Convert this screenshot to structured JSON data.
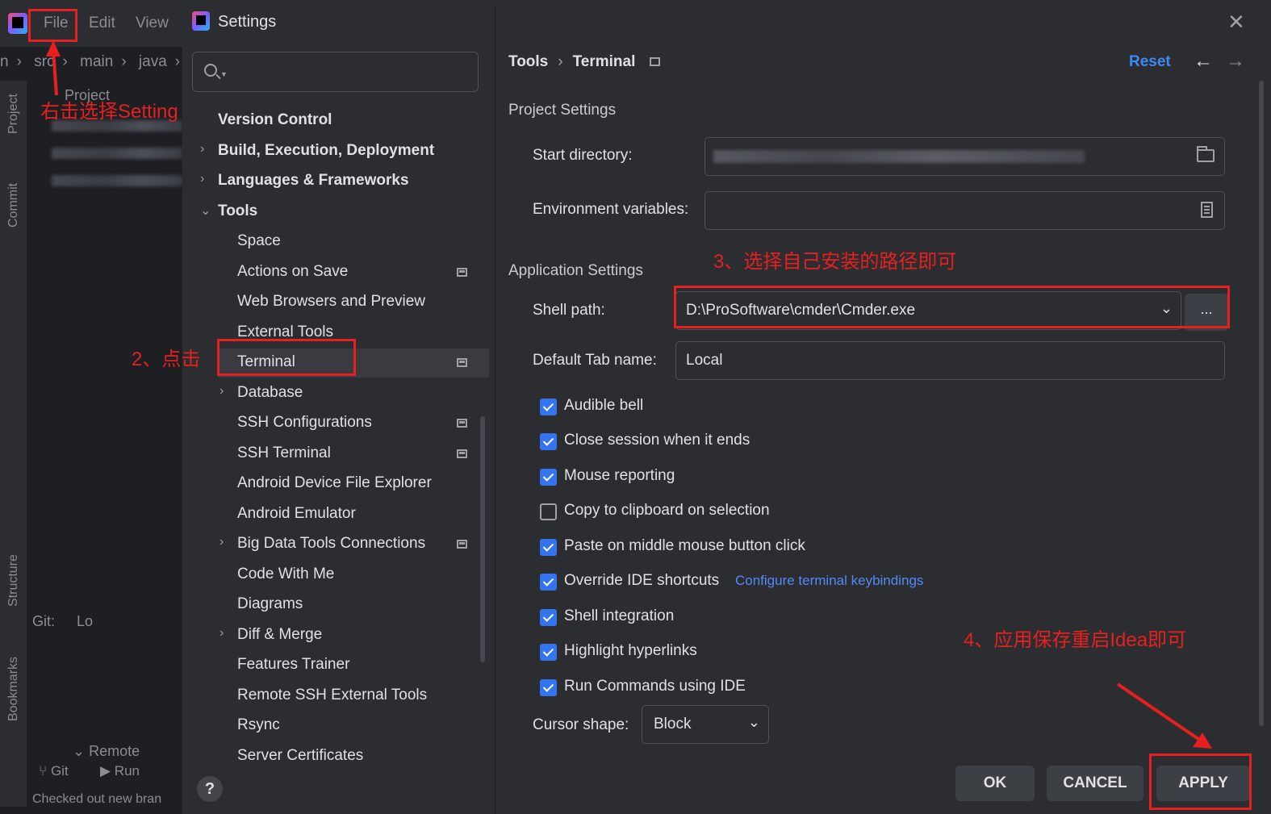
{
  "ide": {
    "menu": [
      "File",
      "Edit",
      "View"
    ],
    "breadcrumb": [
      "n",
      "src",
      "main",
      "java"
    ],
    "left_stripe": [
      "Project",
      "Commit",
      "Structure",
      "Bookmarks"
    ],
    "project_label": "Project",
    "git_tab": "Git:",
    "git_local": "Lo",
    "remote": "Remote",
    "bottom_tools": [
      "Git",
      "Run"
    ],
    "status": "Checked out new bran"
  },
  "dialog": {
    "title": "Settings",
    "search_placeholder": "",
    "tree": [
      {
        "label": "Version Control",
        "level": 0,
        "bold": true,
        "chevron": "",
        "project": false
      },
      {
        "label": "Build, Execution, Deployment",
        "level": 0,
        "bold": true,
        "chevron": "right",
        "project": false
      },
      {
        "label": "Languages & Frameworks",
        "level": 0,
        "bold": true,
        "chevron": "right",
        "project": false
      },
      {
        "label": "Tools",
        "level": 0,
        "bold": true,
        "chevron": "down",
        "project": false
      },
      {
        "label": "Space",
        "level": 1,
        "bold": false,
        "chevron": "",
        "project": false
      },
      {
        "label": "Actions on Save",
        "level": 1,
        "bold": false,
        "chevron": "",
        "project": true
      },
      {
        "label": "Web Browsers and Preview",
        "level": 1,
        "bold": false,
        "chevron": "",
        "project": false
      },
      {
        "label": "External Tools",
        "level": 1,
        "bold": false,
        "chevron": "",
        "project": false
      },
      {
        "label": "Terminal",
        "level": 1,
        "bold": false,
        "chevron": "",
        "project": true,
        "selected": true
      },
      {
        "label": "Database",
        "level": 1,
        "bold": false,
        "chevron": "right",
        "project": false
      },
      {
        "label": "SSH Configurations",
        "level": 1,
        "bold": false,
        "chevron": "",
        "project": true
      },
      {
        "label": "SSH Terminal",
        "level": 1,
        "bold": false,
        "chevron": "",
        "project": true
      },
      {
        "label": "Android Device File Explorer",
        "level": 1,
        "bold": false,
        "chevron": "",
        "project": false
      },
      {
        "label": "Android Emulator",
        "level": 1,
        "bold": false,
        "chevron": "",
        "project": false
      },
      {
        "label": "Big Data Tools Connections",
        "level": 1,
        "bold": false,
        "chevron": "right",
        "project": true
      },
      {
        "label": "Code With Me",
        "level": 1,
        "bold": false,
        "chevron": "",
        "project": false
      },
      {
        "label": "Diagrams",
        "level": 1,
        "bold": false,
        "chevron": "",
        "project": false
      },
      {
        "label": "Diff & Merge",
        "level": 1,
        "bold": false,
        "chevron": "right",
        "project": false
      },
      {
        "label": "Features Trainer",
        "level": 1,
        "bold": false,
        "chevron": "",
        "project": false
      },
      {
        "label": "Remote SSH External Tools",
        "level": 1,
        "bold": false,
        "chevron": "",
        "project": false
      },
      {
        "label": "Rsync",
        "level": 1,
        "bold": false,
        "chevron": "",
        "project": false
      },
      {
        "label": "Server Certificates",
        "level": 1,
        "bold": false,
        "chevron": "",
        "project": false
      }
    ],
    "help_label": "?"
  },
  "content": {
    "breadcrumb": [
      "Tools",
      "Terminal"
    ],
    "reset_label": "Reset",
    "project_settings": "Project Settings",
    "start_directory_label": "Start directory:",
    "env_vars_label": "Environment variables:",
    "env_vars_value": "",
    "application_settings": "Application Settings",
    "shell_path_label": "Shell path:",
    "shell_path_value": "D:\\ProSoftware\\cmder\\Cmder.exe",
    "browse_label": "...",
    "default_tab_label": "Default Tab name:",
    "default_tab_value": "Local",
    "checkboxes": [
      {
        "label": "Audible bell",
        "checked": true
      },
      {
        "label": "Close session when it ends",
        "checked": true
      },
      {
        "label": "Mouse reporting",
        "checked": true
      },
      {
        "label": "Copy to clipboard on selection",
        "checked": false
      },
      {
        "label": "Paste on middle mouse button click",
        "checked": true
      },
      {
        "label": "Override IDE shortcuts",
        "checked": true
      },
      {
        "label": "Shell integration",
        "checked": true
      },
      {
        "label": "Highlight hyperlinks",
        "checked": true
      },
      {
        "label": "Run Commands using IDE",
        "checked": true
      }
    ],
    "keybindings_link": "Configure terminal keybindings",
    "cursor_shape_label": "Cursor shape:",
    "cursor_shape_value": "Block",
    "buttons": {
      "ok": "OK",
      "cancel": "CANCEL",
      "apply": "APPLY"
    }
  },
  "annotations": {
    "step1": "右击选择Setting",
    "step2": "2、点击",
    "step3": "3、选择自己安装的路径即可",
    "step4": "4、应用保存重启Idea即可",
    "color": "#e5201f"
  },
  "colors": {
    "accent": "#3574f0",
    "link": "#548af7",
    "reset": "#3d8af7"
  }
}
